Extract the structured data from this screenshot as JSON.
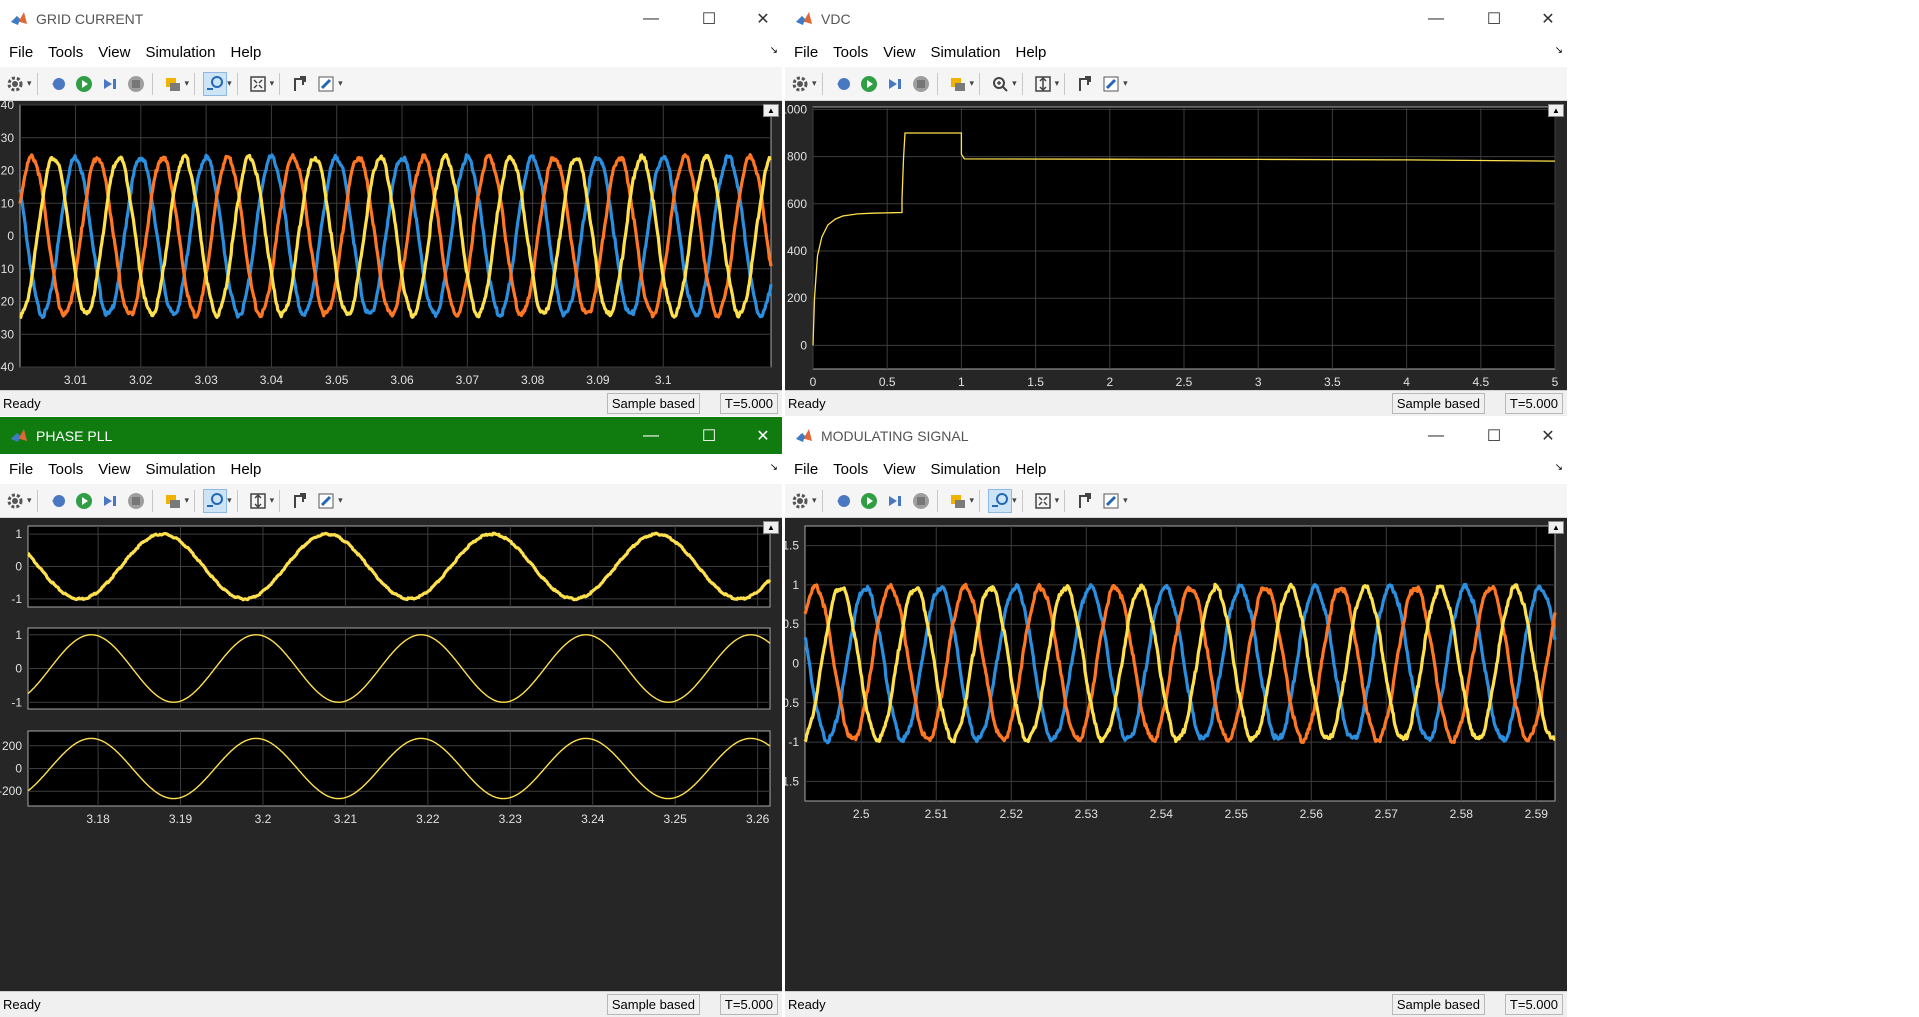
{
  "menus": [
    "File",
    "Tools",
    "View",
    "Simulation",
    "Help"
  ],
  "status": {
    "ready": "Ready",
    "mode": "Sample based",
    "time": "T=5.000"
  },
  "windows": {
    "grid": {
      "title": "GRID CURRENT",
      "chart_data": {
        "type": "line",
        "xlim": [
          3.0015,
          3.1165
        ],
        "ylim": [
          -40,
          40
        ],
        "xticks": [
          "3.01",
          "3.02",
          "3.03",
          "3.04",
          "3.05",
          "3.06",
          "3.07",
          "3.08",
          "3.09",
          "3.1"
        ],
        "yticks": [
          "40",
          "30",
          "20",
          "10",
          "0",
          "-10",
          "-20",
          "-30",
          "-40"
        ],
        "grid": true,
        "series": [
          {
            "color": "#2b8fe0",
            "amplitude": 24,
            "frequency_hz": 100,
            "phase_deg": 90
          },
          {
            "color": "#ff7722",
            "amplitude": 24,
            "frequency_hz": 100,
            "phase_deg": -30
          },
          {
            "color": "#ffe14d",
            "amplitude": 24,
            "frequency_hz": 100,
            "phase_deg": 210
          }
        ]
      }
    },
    "vdc": {
      "title": "VDC",
      "chart_data": {
        "type": "line",
        "xlim": [
          0,
          5
        ],
        "ylim": [
          -100,
          1010
        ],
        "xticks": [
          "0",
          "0.5",
          "1",
          "1.5",
          "2",
          "2.5",
          "3",
          "3.5",
          "4",
          "4.5",
          "5"
        ],
        "yticks": [
          "1000",
          "800",
          "600",
          "400",
          "200",
          "0"
        ],
        "grid": true,
        "series": [
          {
            "color": "#ffe14d",
            "points": [
              [
                0,
                0
              ],
              [
                0.01,
                200
              ],
              [
                0.03,
                380
              ],
              [
                0.06,
                460
              ],
              [
                0.1,
                510
              ],
              [
                0.15,
                535
              ],
              [
                0.2,
                548
              ],
              [
                0.3,
                557
              ],
              [
                0.4,
                560
              ],
              [
                0.6,
                563
              ],
              [
                0.6,
                620
              ],
              [
                0.61,
                790
              ],
              [
                0.62,
                900
              ],
              [
                1.0,
                900
              ],
              [
                1.0,
                810
              ],
              [
                1.02,
                790
              ],
              [
                2,
                789
              ],
              [
                3,
                788
              ],
              [
                4,
                786
              ],
              [
                5,
                781
              ]
            ]
          }
        ]
      }
    },
    "pll": {
      "title": "PHASE PLL",
      "chart_data": [
        {
          "type": "line",
          "xlim": [
            3.1715,
            3.2615
          ],
          "ylim": [
            -1.25,
            1.25
          ],
          "yticks": [
            "1",
            "0",
            "-1"
          ],
          "grid": true,
          "series": [
            {
              "color": "#ffe14d",
              "amplitude": 1,
              "frequency_hz": 50,
              "phase_deg": -50
            }
          ]
        },
        {
          "type": "line",
          "xlim": [
            3.1715,
            3.2615
          ],
          "ylim": [
            -1.2,
            1.2
          ],
          "yticks": [
            "1",
            "0",
            "-1"
          ],
          "grid": true,
          "series": [
            {
              "color": "#ffe14d",
              "amplitude": 1,
              "frequency_hz": 50,
              "phase_deg": 105
            }
          ]
        },
        {
          "type": "line",
          "xlim": [
            3.1715,
            3.2615
          ],
          "ylim": [
            -330,
            330
          ],
          "yticks": [
            "200",
            "0",
            "-200"
          ],
          "grid": true,
          "xticks": [
            "3.18",
            "3.19",
            "3.2",
            "3.21",
            "3.22",
            "3.23",
            "3.24",
            "3.25",
            "3.26"
          ],
          "series": [
            {
              "color": "#ffe14d",
              "amplitude": 265,
              "frequency_hz": 50,
              "phase_deg": 105
            }
          ]
        }
      ]
    },
    "mod": {
      "title": "MODULATING SIGNAL",
      "chart_data": {
        "type": "line",
        "xlim": [
          2.4925,
          2.5925
        ],
        "ylim": [
          -1.75,
          1.75
        ],
        "xticks": [
          "2.5",
          "2.51",
          "2.52",
          "2.53",
          "2.54",
          "2.55",
          "2.56",
          "2.57",
          "2.58",
          "2.59"
        ],
        "yticks": [
          "1.5",
          "1",
          "0.5",
          "0",
          "-0.5",
          "-1",
          "-1.5"
        ],
        "grid": true,
        "series": [
          {
            "color": "#2b8fe0",
            "amplitude": 0.97,
            "frequency_hz": 100,
            "phase_deg": 70
          },
          {
            "color": "#ff7722",
            "amplitude": 0.97,
            "frequency_hz": 100,
            "phase_deg": -50
          },
          {
            "color": "#ffe14d",
            "amplitude": 0.97,
            "frequency_hz": 100,
            "phase_deg": 190
          }
        ]
      }
    }
  }
}
